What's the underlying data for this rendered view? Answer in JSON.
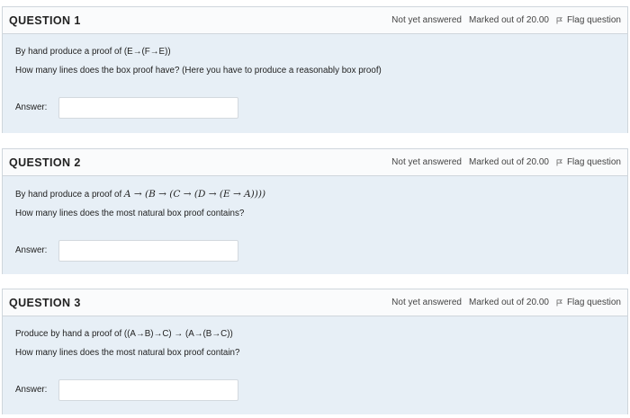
{
  "questions": [
    {
      "title": "QUESTION 1",
      "status": "Not yet answered",
      "marks": "Marked out of 20.00",
      "flag": "Flag question",
      "prompt": "By hand produce a proof of  (E→(F→E))",
      "prompt_math": "",
      "subprompt": "How many lines does the box proof have?   (Here you have to produce a reasonably box proof)",
      "answer_label": "Answer:",
      "answer_value": ""
    },
    {
      "title": "QUESTION 2",
      "status": "Not yet answered",
      "marks": "Marked out of 20.00",
      "flag": "Flag question",
      "prompt": "By hand produce a proof of ",
      "prompt_math": "A → (B → (C → (D → (E → A))))",
      "subprompt": "How many lines does the most natural box proof contains?",
      "answer_label": "Answer:",
      "answer_value": ""
    },
    {
      "title": "QUESTION 3",
      "status": "Not yet answered",
      "marks": "Marked out of 20.00",
      "flag": "Flag question",
      "prompt": "Produce by hand a proof of  ((A→B)→C) → (A→(B→C))",
      "prompt_math": "",
      "subprompt": "How many lines does the most natural box proof contain?",
      "answer_label": "Answer:",
      "answer_value": ""
    }
  ],
  "icons": {
    "flag": "flag-icon"
  },
  "colors": {
    "body_bg": "#e7eff6",
    "border": "#cfd6dc"
  }
}
